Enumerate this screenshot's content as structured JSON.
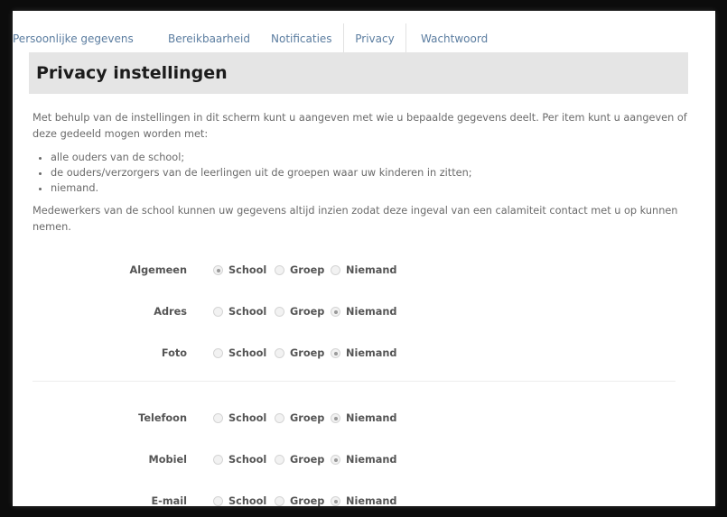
{
  "tabs": [
    {
      "label": "Persoonlijke gegevens",
      "active": false
    },
    {
      "label": "Bereikbaarheid",
      "active": false
    },
    {
      "label": "Notificaties",
      "active": false
    },
    {
      "label": "Privacy",
      "active": true
    },
    {
      "label": "Wachtwoord",
      "active": false
    }
  ],
  "page": {
    "title": "Privacy instellingen",
    "intro": "Met behulp van de instellingen in dit scherm kunt u aangeven met wie u bepaalde gegevens deelt. Per item kunt u aangeven of deze gedeeld mogen worden met:",
    "bullets": [
      "alle ouders van de school;",
      "de ouders/verzorgers van de leerlingen uit de groepen waar uw kinderen in zitten;",
      "niemand."
    ],
    "note": "Medewerkers van de school kunnen uw gegevens altijd inzien zodat deze ingeval van een calamiteit contact met u op kunnen nemen."
  },
  "options": {
    "school": "School",
    "groep": "Groep",
    "niemand": "Niemand"
  },
  "settings": [
    {
      "label": "Algemeen",
      "selected": "school"
    },
    {
      "label": "Adres",
      "selected": "niemand"
    },
    {
      "label": "Foto",
      "selected": "niemand"
    },
    {
      "label": "Telefoon",
      "selected": "niemand"
    },
    {
      "label": "Mobiel",
      "selected": "niemand"
    },
    {
      "label": "E-mail",
      "selected": "niemand"
    }
  ]
}
